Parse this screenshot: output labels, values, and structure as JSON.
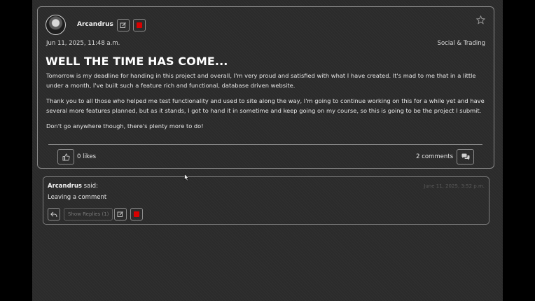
{
  "post": {
    "author": "Arcandrus",
    "date": "Jun 11, 2025, 11:48 a.m.",
    "category": "Social & Trading",
    "title": "WELL THE TIME HAS COME...",
    "paragraphs": [
      "Tomorrow is my deadline for handing in this project and overall, I'm very proud and satisfied with what I have created. It's mad to me that in a little under a month, I've built such a feature rich and functional, database driven website.",
      "Thank you to all those who helped me test functionality and used to site along the way, I'm going to continue working on this for a while yet and have several more features planned, but as it stands, I got to hand it in sometime and keep going on my course, so this is going to be the project I submit.",
      "Don't go anywhere though, there's plenty more to do!"
    ],
    "likes": "0 likes",
    "comments": "2 comments"
  },
  "comment": {
    "author": "Arcandrus",
    "said": " said:",
    "time": "June 11, 2025, 3:52 p.m.",
    "text": "Leaving a comment",
    "show_replies": "Show Replies (1)"
  },
  "colors": {
    "background": "#2b2b2b",
    "delete_red": "#d90000",
    "border": "#8a8a8a"
  },
  "icons": [
    "edit-icon",
    "delete-icon",
    "star-icon",
    "thumbs-up-icon",
    "comments-icon",
    "reply-icon",
    "cursor-icon"
  ]
}
